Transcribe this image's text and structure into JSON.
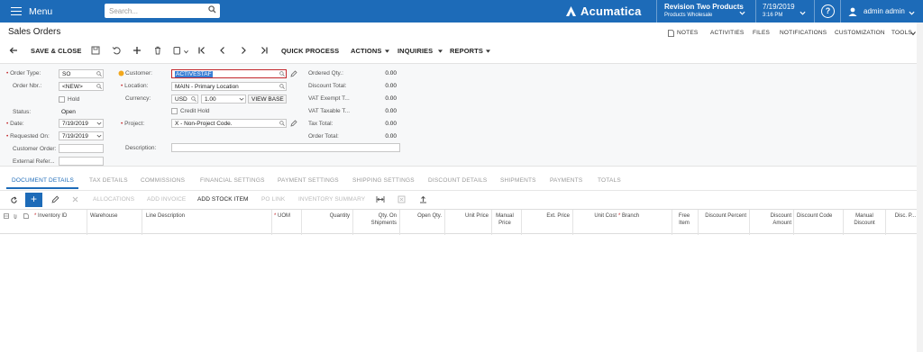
{
  "topbar": {
    "menu_label": "Menu",
    "search_placeholder": "Search...",
    "brand": "Acumatica",
    "company_name": "Revision Two Products",
    "company_branch": "Products Wholesale",
    "date": "7/19/2019",
    "time": "3:16 PM",
    "help": "?",
    "user": "admin admin"
  },
  "titlebar": {
    "title": "Sales Orders",
    "links": [
      "NOTES",
      "ACTIVITIES",
      "FILES",
      "NOTIFICATIONS",
      "CUSTOMIZATION",
      "TOOLS"
    ]
  },
  "toolbar": {
    "save_close": "SAVE & CLOSE",
    "quick_process": "QUICK PROCESS",
    "actions": "ACTIONS",
    "inquiries": "INQUIRIES",
    "reports": "REPORTS"
  },
  "form": {
    "order_type_label": "Order Type:",
    "order_type": "SO",
    "order_nbr_label": "Order Nbr.:",
    "order_nbr": "<NEW>",
    "hold_label": "Hold",
    "status_label": "Status:",
    "status": "Open",
    "date_label": "Date:",
    "date": "7/19/2019",
    "requested_on_label": "Requested On:",
    "requested_on": "7/19/2019",
    "customer_order_label": "Customer Order:",
    "external_ref_label": "External Refer...",
    "customer_label": "Customer:",
    "customer": "ACTIVESTAF",
    "location_label": "Location:",
    "location": "MAIN - Primary Location",
    "currency_label": "Currency:",
    "currency": "USD",
    "rate": "1.00",
    "view_base": "VIEW BASE",
    "credit_hold_label": "Credit Hold",
    "project_label": "Project:",
    "project": "X - Non-Project Code.",
    "description_label": "Description:",
    "totals": [
      {
        "label": "Ordered Qty.:",
        "value": "0.00"
      },
      {
        "label": "Discount Total:",
        "value": "0.00"
      },
      {
        "label": "VAT Exempt T...",
        "value": "0.00"
      },
      {
        "label": "VAT Taxable T...",
        "value": "0.00"
      },
      {
        "label": "Tax Total:",
        "value": "0.00"
      },
      {
        "label": "Order Total:",
        "value": "0.00"
      }
    ]
  },
  "tabs": [
    "DOCUMENT DETAILS",
    "TAX DETAILS",
    "COMMISSIONS",
    "FINANCIAL SETTINGS",
    "PAYMENT SETTINGS",
    "SHIPPING SETTINGS",
    "DISCOUNT DETAILS",
    "SHIPMENTS",
    "PAYMENTS",
    "TOTALS"
  ],
  "grid_toolbar": {
    "allocations": "ALLOCATIONS",
    "add_invoice": "ADD INVOICE",
    "add_stock_item": "ADD STOCK ITEM",
    "po_link": "PO LINK",
    "inventory_summary": "INVENTORY SUMMARY"
  },
  "grid_columns": [
    "Inventory ID",
    "Warehouse",
    "Line Description",
    "UOM",
    "Quantity",
    "Qty. On Shipments",
    "Open Qty.",
    "Unit Price",
    "Manual Price",
    "Ext. Price",
    "Unit Cost",
    "Branch",
    "Free Item",
    "Discount Percent",
    "Discount Amount",
    "Discount Code",
    "Manual Discount",
    "Disc. P..."
  ],
  "colors": {
    "accent": "#1d6bb8",
    "required": "#c3272b"
  }
}
